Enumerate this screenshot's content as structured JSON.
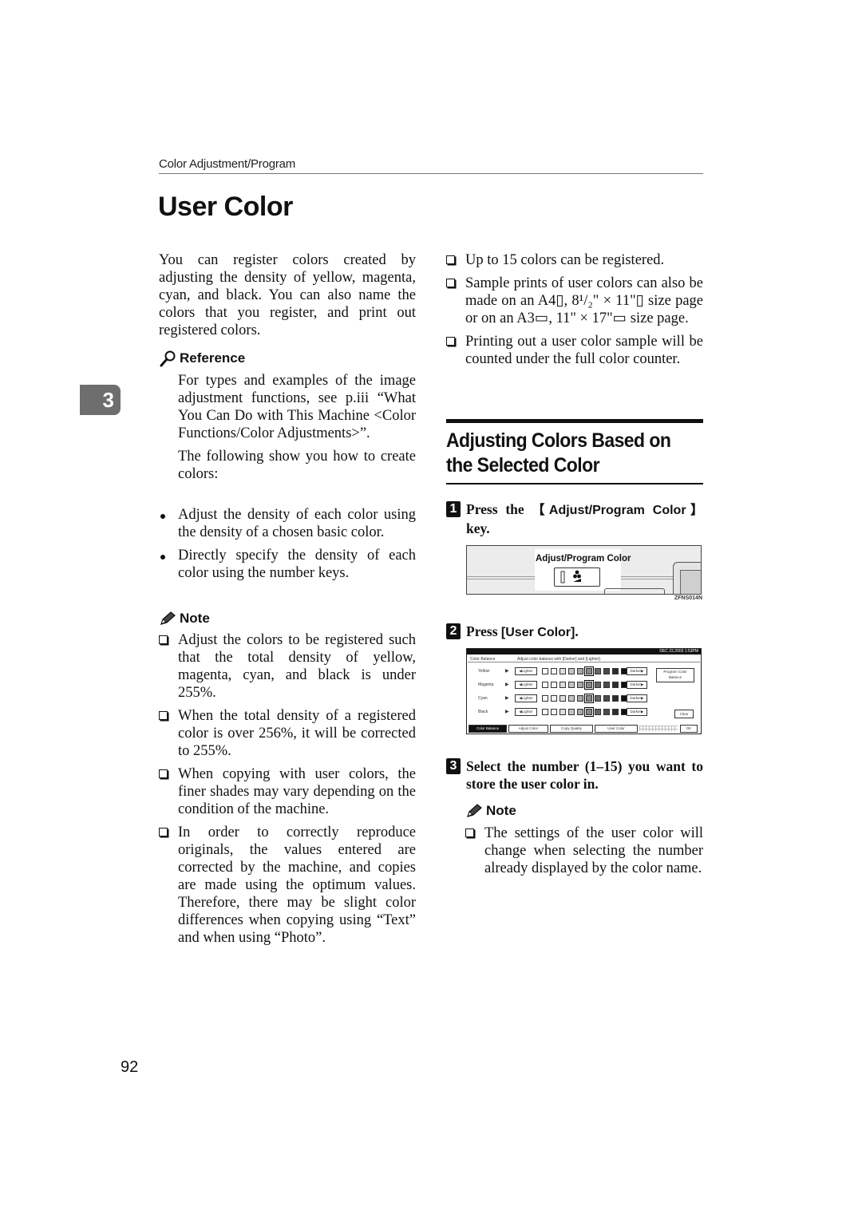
{
  "running_head": "Color Adjustment/Program",
  "title": "User Color",
  "chapter_tab": "3",
  "page_number": "92",
  "left_column": {
    "intro": "You can register colors created by adjusting the density of yellow, magenta, cyan, and black. You can also name the colors that you register, and print out registered colors.",
    "reference": {
      "heading": "Reference",
      "icon": "magnifier-icon",
      "text": "For types and examples of the image adjustment functions, see p.iii “What You Can Do with This Machine <Color Functions/Color Adjustments>”.",
      "follow": "The following show you how to create colors:"
    },
    "bullets": [
      "Adjust the density of each color using the density of a chosen basic color.",
      "Directly specify the density of each color using the number keys."
    ],
    "note": {
      "heading": "Note",
      "icon": "pencil-icon",
      "items": [
        "Adjust the colors to be registered such that the total density of yellow, magenta, cyan, and black is under 255%.",
        "When the total density of a registered color is over 256%, it will be corrected to 255%.",
        "When copying with user colors, the finer shades may vary depending on the condition of the machine.",
        "In order to correctly reproduce originals, the values entered are corrected by the machine, and copies are made using the optimum values. Therefore, there may be slight color differences when copying using “Text” and when using “Photo”."
      ]
    }
  },
  "right_column": {
    "notes_top": [
      "Up to 15 colors can be registered.",
      "Sample prints of user colors can also be made on an A4▯, 8¹/₂\" × 11\"▯ size page or on an A3▭, 11\" × 17\"▭ size page.",
      "Printing out a user color sample will be counted under the full color counter."
    ],
    "section_title": "Adjusting Colors Based on the Selected Color",
    "steps": [
      {
        "num": "1",
        "prefix": "Press the ",
        "key": "【Adjust/Program Color】",
        "suffix": " key."
      },
      {
        "num": "2",
        "prefix": "Press ",
        "key": "[User Color]",
        "suffix": "."
      },
      {
        "num": "3",
        "prefix": "Select the number (1–15) you want to store the user color in.",
        "key": "",
        "suffix": ""
      }
    ],
    "panel_figure": {
      "key_label": "Adjust/Program Color",
      "figure_code": "ZFNS014N"
    },
    "screen_figure": {
      "datetime": "DEC  22,2003  1:53PM",
      "header_left": "Color Balance",
      "header_right": "Adjust color balance with [Darker] and [Lighter].",
      "rows": [
        {
          "name": "Yellow",
          "lighter": "◀Lighter",
          "darker": "Darker▶",
          "level": 6
        },
        {
          "name": "Magenta",
          "lighter": "◀Lighter",
          "darker": "Darker▶",
          "level": 6
        },
        {
          "name": "Cyan",
          "lighter": "◀Lighter",
          "darker": "Darker▶",
          "level": 6
        },
        {
          "name": "Black",
          "lighter": "◀Lighter",
          "darker": "Darker▶",
          "level": 6
        }
      ],
      "program_button": "Program Color Balance",
      "clear_button": "Clear",
      "tabs": [
        "Color Balance",
        "Adjust Color",
        "Copy Quality",
        "User Color"
      ],
      "ok_button": "OK"
    },
    "note": {
      "heading": "Note",
      "icon": "pencil-icon",
      "items": [
        "The settings of the user color will change when selecting the number already displayed by the color name."
      ]
    }
  }
}
